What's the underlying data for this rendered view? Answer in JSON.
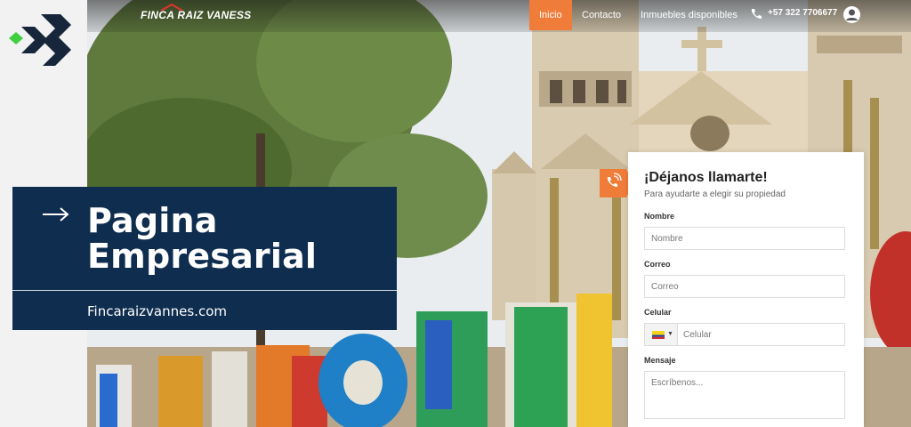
{
  "site": {
    "logo_text": "FINCA RAIZ VANESS",
    "nav": {
      "inicio": "Inicio",
      "contacto": "Contacto",
      "inmuebles": "Inmuebles disponibles",
      "phone": "+57 322 7706677"
    }
  },
  "banner": {
    "title_line1": "Pagina",
    "title_line2": "Empresarial",
    "url": "Fincaraizvannes.com"
  },
  "form": {
    "title": "¡Déjanos llamarte!",
    "subtitle": "Para ayudarte a elegir su propiedad",
    "fields": {
      "nombre": {
        "label": "Nombre",
        "placeholder": "Nombre"
      },
      "correo": {
        "label": "Correo",
        "placeholder": "Correo"
      },
      "celular": {
        "label": "Celular",
        "placeholder": "Celular"
      },
      "mensaje": {
        "label": "Mensaje",
        "placeholder": "Escríbenos..."
      }
    }
  },
  "colors": {
    "accent": "#f07c3a",
    "banner_navy": "#0f2e4f"
  },
  "icons": [
    "brand-logo-icon",
    "phone-icon",
    "user-icon",
    "arrow-right-icon",
    "call-icon",
    "colombia-flag-icon"
  ]
}
